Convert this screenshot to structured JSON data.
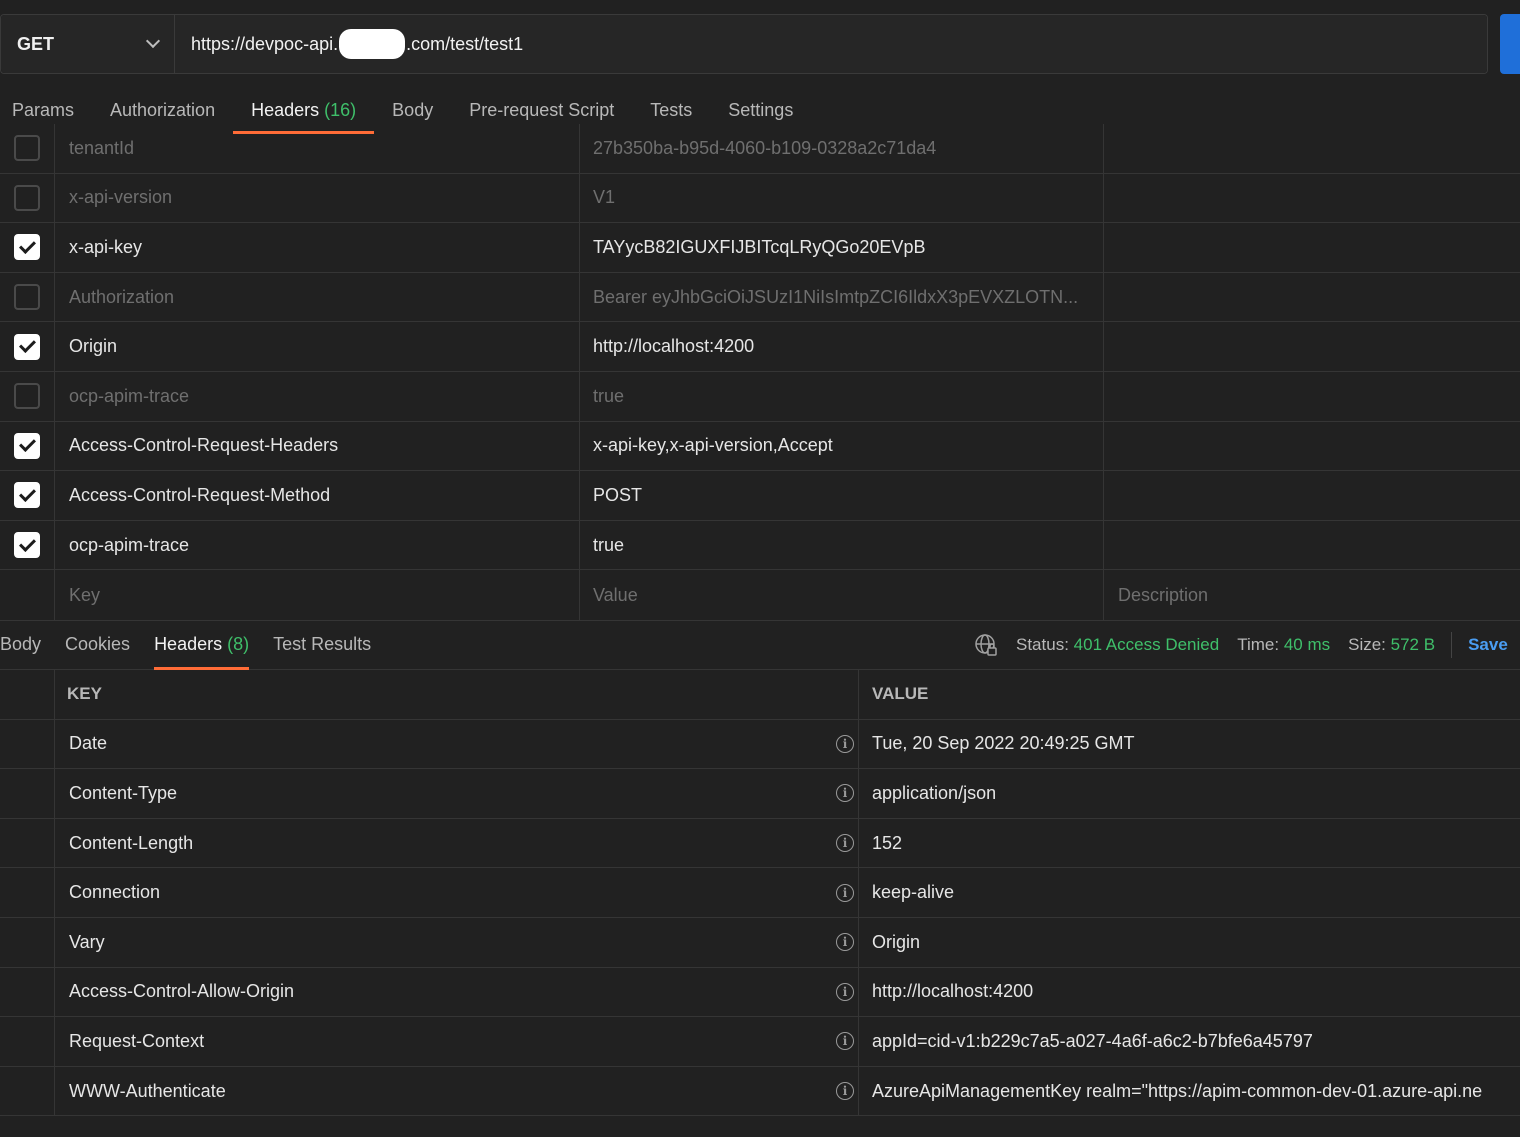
{
  "request": {
    "method": "GET",
    "url_prefix": "https://devpoc-api.",
    "url_suffix": ".com/test/test1"
  },
  "request_tabs": [
    {
      "label": "Params"
    },
    {
      "label": "Authorization"
    },
    {
      "label": "Headers",
      "count": "(16)",
      "active": true
    },
    {
      "label": "Body"
    },
    {
      "label": "Pre-request Script"
    },
    {
      "label": "Tests"
    },
    {
      "label": "Settings"
    }
  ],
  "request_headers": [
    {
      "key": "tenantId",
      "value": "27b350ba-b95d-4060-b109-0328a2c71da4",
      "enabled": false
    },
    {
      "key": "x-api-version",
      "value": "V1",
      "enabled": false
    },
    {
      "key": "x-api-key",
      "value": "TAYycB82IGUXFIJBITcqLRyQGo20EVpB",
      "enabled": true
    },
    {
      "key": "Authorization",
      "value": "Bearer eyJhbGciOiJSUzI1NiIsImtpZCI6IldxX3pEVXZLOTN...",
      "enabled": false
    },
    {
      "key": "Origin",
      "value": "http://localhost:4200",
      "enabled": true
    },
    {
      "key": "ocp-apim-trace",
      "value": "true",
      "enabled": false
    },
    {
      "key": "Access-Control-Request-Headers",
      "value": "x-api-key,x-api-version,Accept",
      "enabled": true
    },
    {
      "key": "Access-Control-Request-Method",
      "value": "POST",
      "enabled": true
    },
    {
      "key": "ocp-apim-trace",
      "value": "true",
      "enabled": true
    }
  ],
  "new_row": {
    "key_placeholder": "Key",
    "value_placeholder": "Value",
    "description_placeholder": "Description"
  },
  "response_tabs": [
    {
      "label": "Body"
    },
    {
      "label": "Cookies"
    },
    {
      "label": "Headers",
      "count": "(8)",
      "active": true
    },
    {
      "label": "Test Results"
    }
  ],
  "response_status": {
    "status_label": "Status:",
    "status_value": "401 Access Denied",
    "time_label": "Time:",
    "time_value": "40 ms",
    "size_label": "Size:",
    "size_value": "572 B",
    "save_label": "Save"
  },
  "response_table": {
    "key_header": "KEY",
    "value_header": "VALUE",
    "rows": [
      {
        "key": "Date",
        "value": "Tue, 20 Sep 2022 20:49:25 GMT"
      },
      {
        "key": "Content-Type",
        "value": "application/json"
      },
      {
        "key": "Content-Length",
        "value": "152"
      },
      {
        "key": "Connection",
        "value": "keep-alive"
      },
      {
        "key": "Vary",
        "value": "Origin"
      },
      {
        "key": "Access-Control-Allow-Origin",
        "value": "http://localhost:4200"
      },
      {
        "key": "Request-Context",
        "value": "appId=cid-v1:b229c7a5-a027-4a6f-a6c2-b7bfe6a45797"
      },
      {
        "key": "WWW-Authenticate",
        "value": "AzureApiManagementKey realm=\"https://apim-common-dev-01.azure-api.ne"
      }
    ]
  },
  "colors": {
    "accent": "#ff6c37",
    "success": "#3fbf6a",
    "link": "#4a9df2",
    "send": "#1f6fd9"
  }
}
